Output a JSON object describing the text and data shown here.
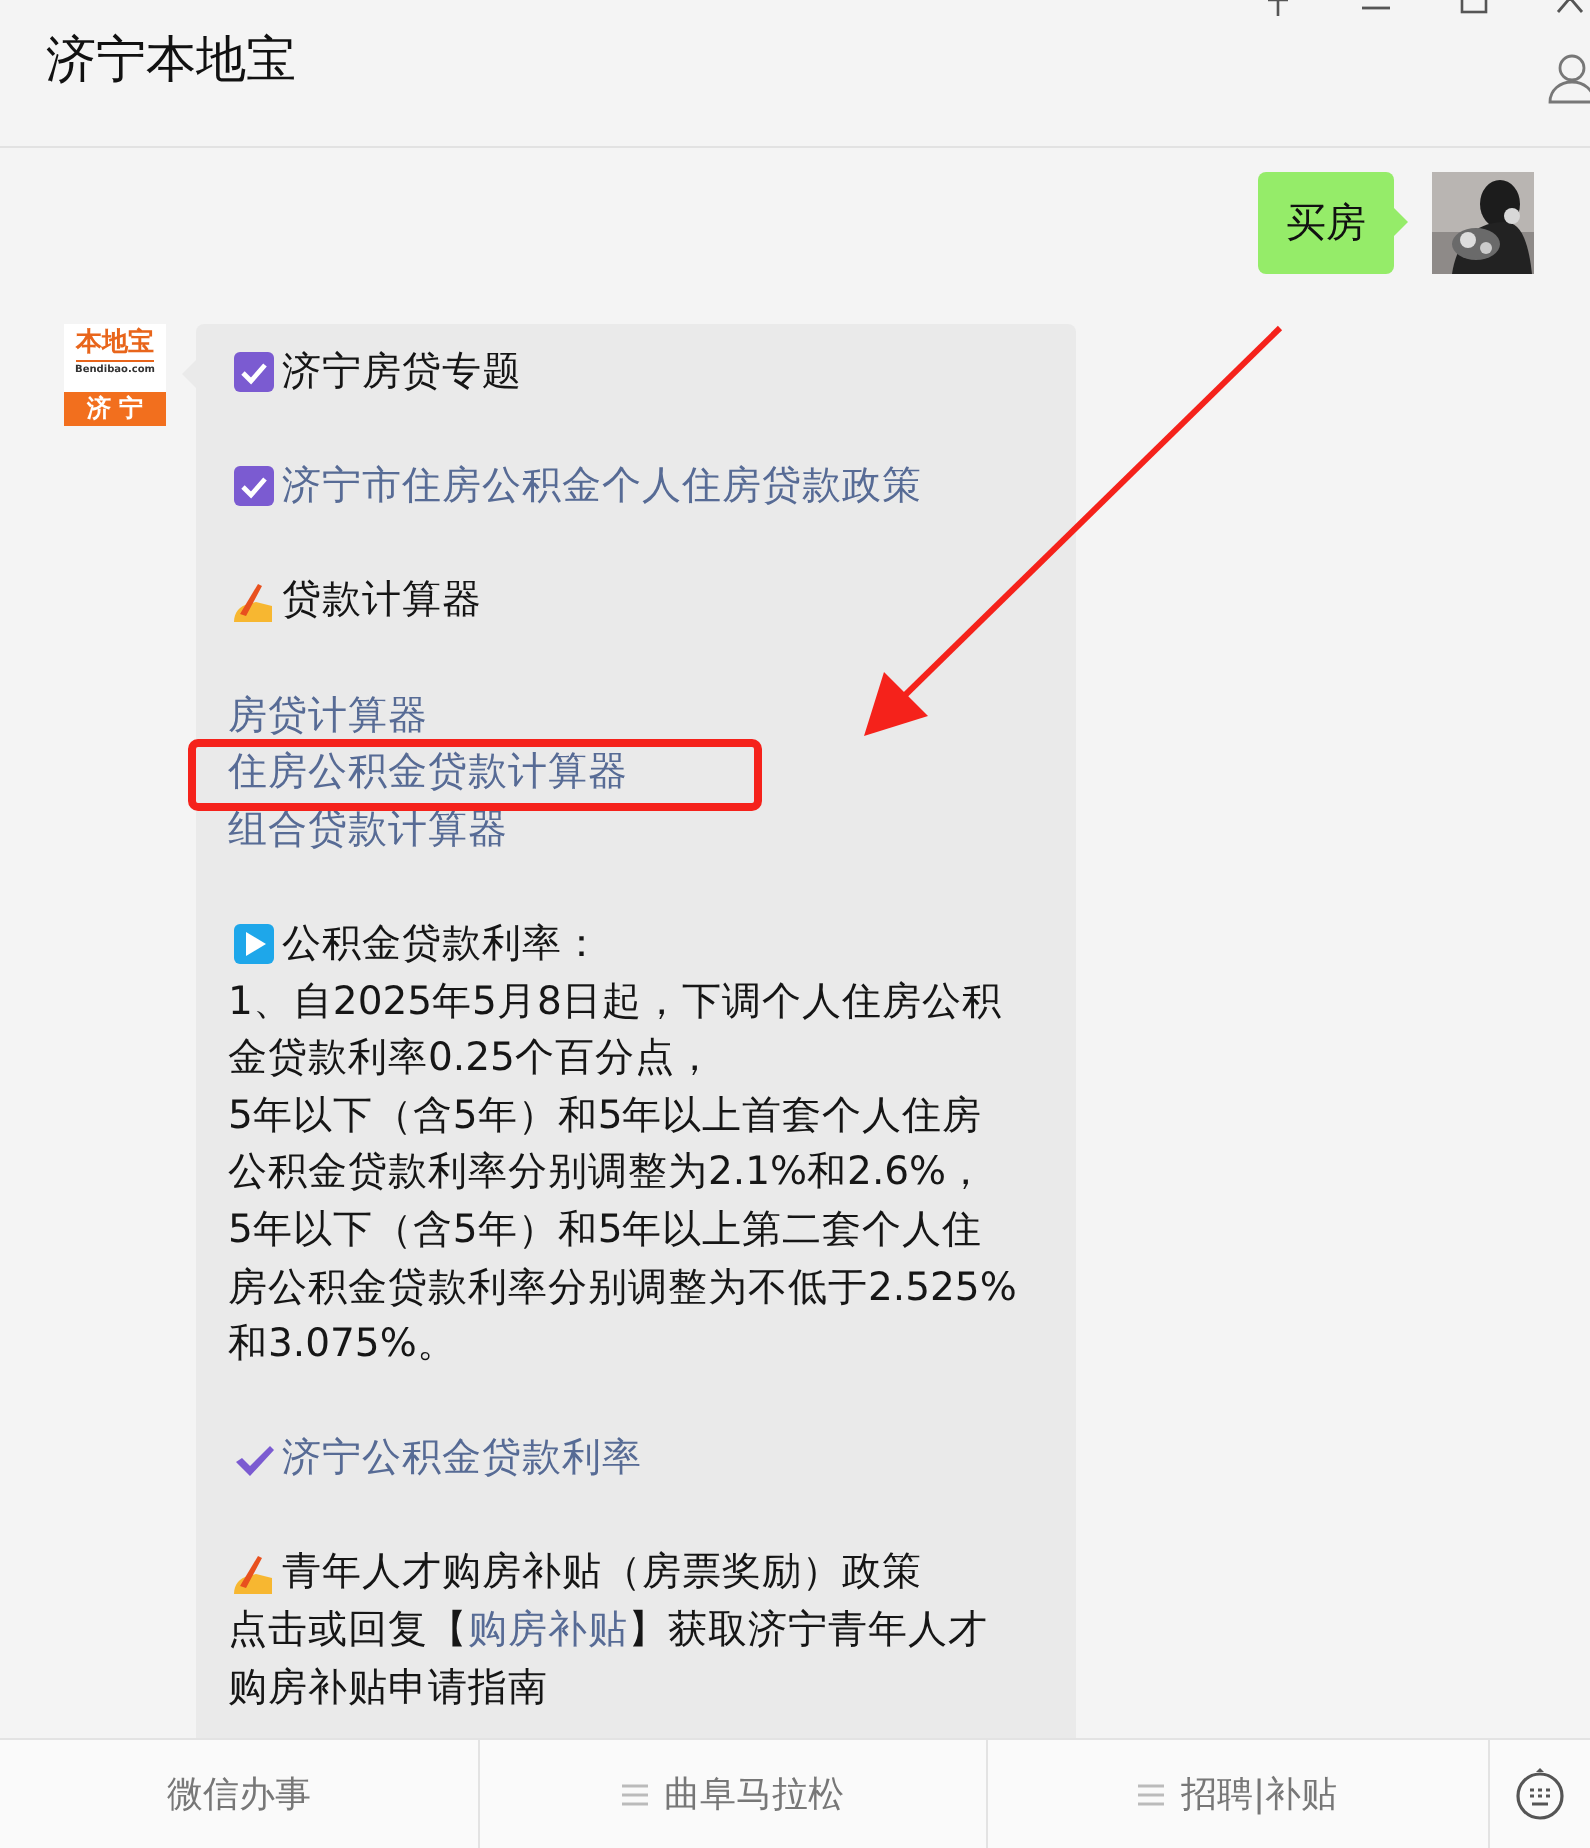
{
  "window": {
    "title": "济宁本地宝"
  },
  "messages": [
    {
      "kind": "outgoing",
      "text": "买房"
    },
    {
      "kind": "incoming",
      "logo": {
        "brand": "本地宝",
        "site": "Bendibao.com",
        "city": "济 宁"
      },
      "sections": [
        [
          {
            "kind": "check-title",
            "parts": [
              {
                "text": "济宁房贷专题",
                "link": false
              }
            ]
          }
        ],
        [
          {
            "kind": "check-title",
            "parts": [
              {
                "text": "济宁市住房公积金个人住房贷款政策",
                "link": true
              }
            ]
          }
        ],
        [
          {
            "kind": "pen-title",
            "parts": [
              {
                "text": "贷款计算器",
                "link": false
              }
            ]
          }
        ],
        [
          {
            "kind": "plain",
            "parts": [
              {
                "text": "房贷计算器",
                "link": true
              }
            ]
          },
          {
            "kind": "plain",
            "parts": [
              {
                "text": "住房公积金贷款计算器",
                "link": true
              }
            ]
          },
          {
            "kind": "plain",
            "parts": [
              {
                "text": "组合贷款计算器",
                "link": true
              }
            ]
          }
        ],
        [
          {
            "kind": "play-title",
            "parts": [
              {
                "text": "公积金贷款利率：",
                "link": false
              }
            ]
          },
          {
            "kind": "plain",
            "parts": [
              {
                "text": "1、自2025年5月8日起，下调个人住房公积",
                "link": false
              }
            ]
          },
          {
            "kind": "plain",
            "parts": [
              {
                "text": "金贷款利率0.25个百分点，",
                "link": false
              }
            ]
          },
          {
            "kind": "plain",
            "parts": [
              {
                "text": "5年以下（含5年）和5年以上首套个人住房",
                "link": false
              }
            ]
          },
          {
            "kind": "plain",
            "parts": [
              {
                "text": "公积金贷款利率分别调整为2.1%和2.6%，",
                "link": false
              }
            ]
          },
          {
            "kind": "plain",
            "parts": [
              {
                "text": "5年以下（含5年）和5年以上第二套个人住",
                "link": false
              }
            ]
          },
          {
            "kind": "plain",
            "parts": [
              {
                "text": "房公积金贷款利率分别调整为不低于2.525%",
                "link": false
              }
            ]
          },
          {
            "kind": "plain",
            "parts": [
              {
                "text": "和3.075%。",
                "link": false
              }
            ]
          }
        ],
        [
          {
            "kind": "tick-title",
            "parts": [
              {
                "text": "济宁公积金贷款利率",
                "link": true
              }
            ]
          }
        ],
        [
          {
            "kind": "pen-title",
            "parts": [
              {
                "text": "青年人才购房补贴（房票奖励）政策",
                "link": false
              }
            ]
          },
          {
            "kind": "plain",
            "parts": [
              {
                "text": "点击或回复【",
                "link": false
              },
              {
                "text": "购房补贴",
                "link": true
              },
              {
                "text": "】获取济宁青年人才",
                "link": false
              }
            ]
          },
          {
            "kind": "plain",
            "parts": [
              {
                "text": "购房补贴申请指南",
                "link": false
              }
            ]
          }
        ]
      ]
    }
  ],
  "menu": [
    {
      "label": "微信办事",
      "submenu": false
    },
    {
      "label": "曲阜马拉松",
      "submenu": true
    },
    {
      "label": "招聘|补贴",
      "submenu": true
    }
  ]
}
